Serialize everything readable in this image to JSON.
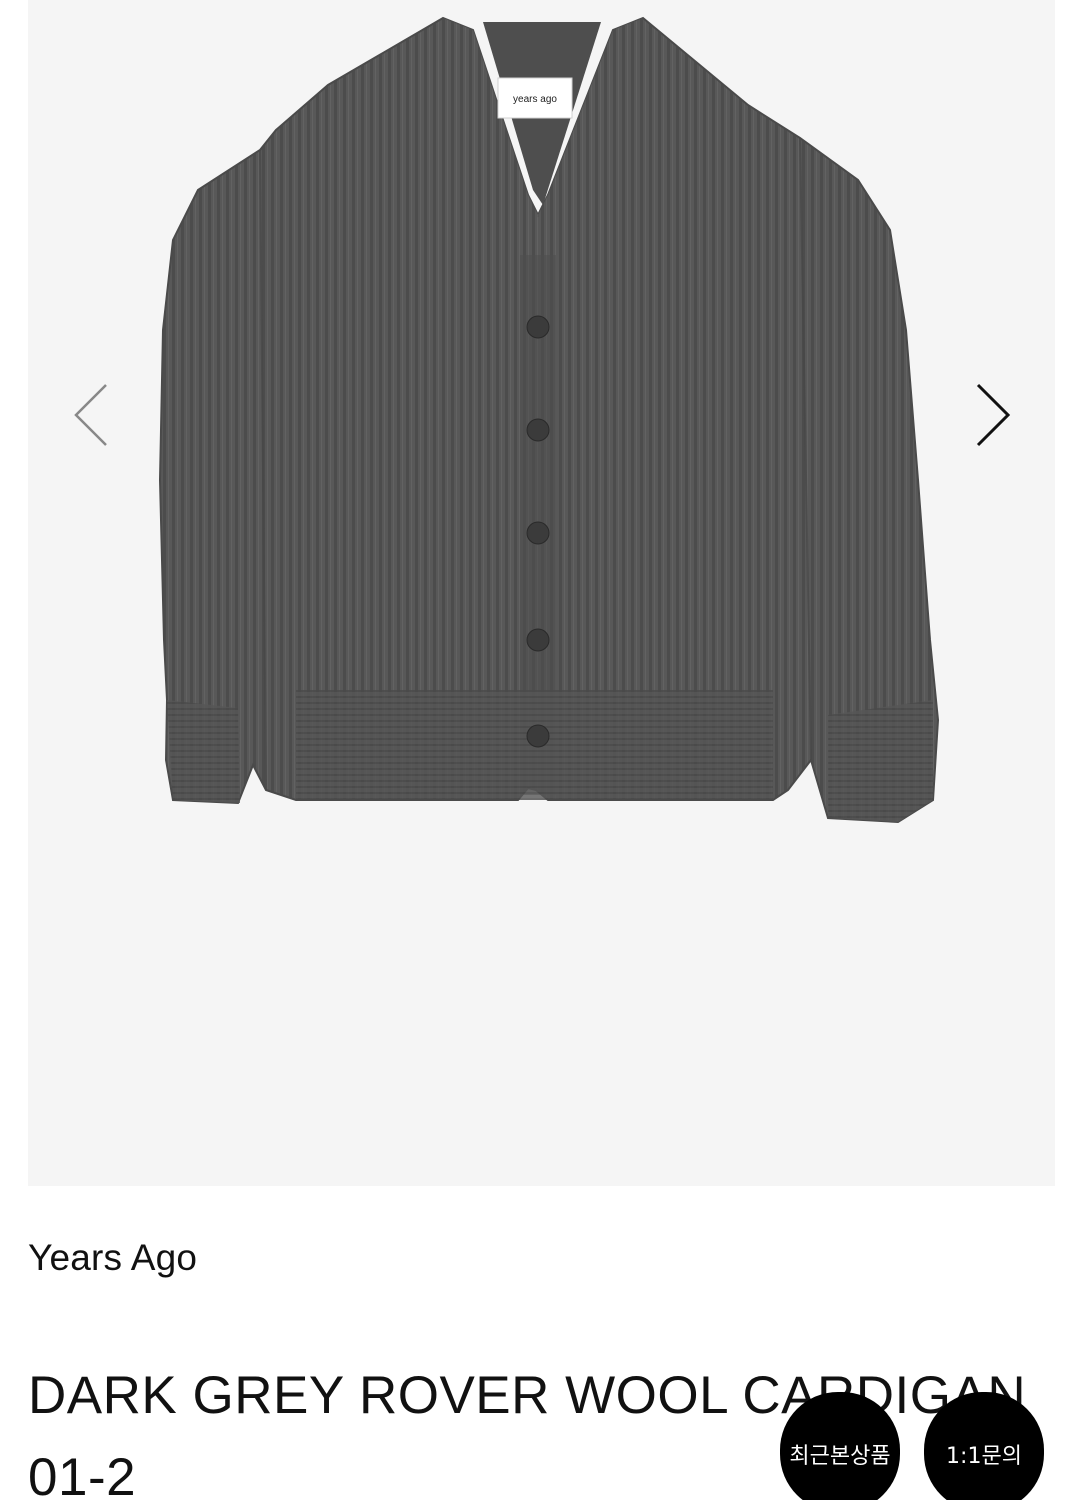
{
  "product": {
    "brand": "Years Ago",
    "title": "DARK GREY ROVER WOOL CARDIGAN 01-2",
    "image_label": "years ago"
  },
  "gallery": {
    "prev_icon": "chevron-left-icon",
    "next_icon": "chevron-right-icon"
  },
  "floating": {
    "recent_label": "최근본상품",
    "inquiry_label": "1:1문의"
  },
  "colors": {
    "gallery_bg": "#f5f5f5",
    "cardigan": "#555555",
    "button_bg": "#000000",
    "text": "#111111"
  }
}
